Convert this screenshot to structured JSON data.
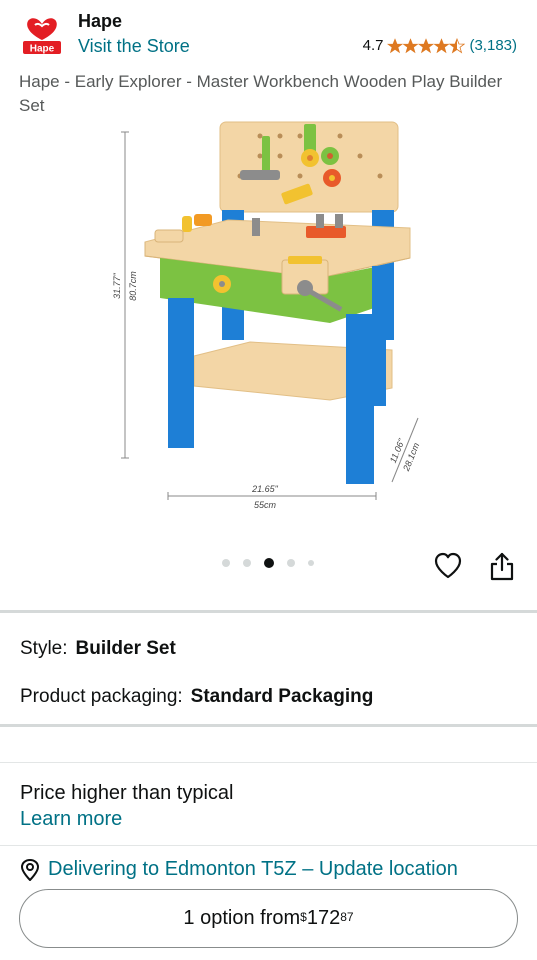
{
  "header": {
    "brand": "Hape",
    "logo_text": "Hape",
    "visit_store": "Visit the Store",
    "rating_value": "4.7",
    "rating_stars": 4.5,
    "rating_count": "(3,183)"
  },
  "product": {
    "title": "Hape - Early Explorer - Master Workbench Wooden Play Builder Set",
    "image_dimensions": {
      "height_in": "31.77\"",
      "height_cm": "80.7cm",
      "width_in": "21.65\"",
      "width_cm": "55cm",
      "depth_in": "11.06\"",
      "depth_cm": "28.1cm"
    },
    "image_count": 5,
    "active_image_index": 2
  },
  "icons": {
    "favorite": "heart-icon",
    "share": "share-icon",
    "location": "location-pin-icon"
  },
  "specs": {
    "style_label": "Style:",
    "style_value": "Builder Set",
    "packaging_label": "Product packaging:",
    "packaging_value": "Standard Packaging"
  },
  "pricing": {
    "note": "Price higher than typical",
    "learn_more": "Learn more",
    "option_prefix": "1 option from ",
    "currency": "$",
    "whole": "172",
    "fraction": "87"
  },
  "delivery": {
    "text": "Delivering to Edmonton T5Z – Update location"
  },
  "colors": {
    "link": "#007185",
    "star": "#de7921",
    "logo_red": "#e31e24",
    "bench_blue": "#1e7fd6",
    "bench_green": "#7cc242",
    "wood": "#f3d6a6"
  }
}
